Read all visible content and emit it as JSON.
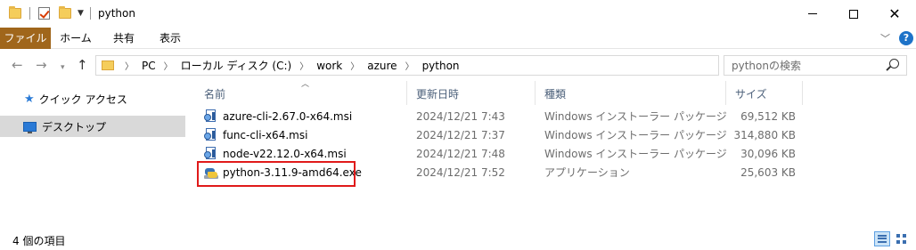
{
  "window": {
    "title": "python",
    "quick_access_icons": [
      "folder-icon",
      "properties-check-icon",
      "new-folder-icon",
      "customize-dropdown-icon"
    ]
  },
  "ribbon": {
    "tabs": [
      {
        "label": "ファイル",
        "active": true
      },
      {
        "label": "ホーム"
      },
      {
        "label": "共有"
      },
      {
        "label": "表示"
      }
    ]
  },
  "address": {
    "breadcrumbs": [
      "PC",
      "ローカル ディスク (C:)",
      "work",
      "azure",
      "python"
    ]
  },
  "search": {
    "placeholder": "pythonの検索"
  },
  "navpane": {
    "items": [
      {
        "label": "クイック アクセス",
        "icon": "star-icon",
        "selected": false
      },
      {
        "label": "デスクトップ",
        "icon": "desktop-icon",
        "selected": true
      }
    ]
  },
  "columns": {
    "name": "名前",
    "date": "更新日時",
    "type": "種類",
    "size": "サイズ"
  },
  "files": [
    {
      "name": "azure-cli-2.67.0-x64.msi",
      "date": "2024/12/21 7:43",
      "type": "Windows インストーラー パッケージ",
      "size": "69,512 KB",
      "icon": "msi-installer-icon"
    },
    {
      "name": "func-cli-x64.msi",
      "date": "2024/12/21 7:37",
      "type": "Windows インストーラー パッケージ",
      "size": "314,880 KB",
      "icon": "msi-installer-icon"
    },
    {
      "name": "node-v22.12.0-x64.msi",
      "date": "2024/12/21 7:48",
      "type": "Windows インストーラー パッケージ",
      "size": "30,096 KB",
      "icon": "msi-installer-icon"
    },
    {
      "name": "python-3.11.9-amd64.exe",
      "date": "2024/12/21 7:52",
      "type": "アプリケーション",
      "size": "25,603 KB",
      "icon": "python-installer-icon",
      "highlighted": true
    }
  ],
  "status": {
    "item_count": "4 個の項目"
  },
  "colors": {
    "file_tab": "#a0661b",
    "highlight_border": "#e01a1a",
    "column_header_text": "#4c607a",
    "selection_bg": "#d9d9d9"
  }
}
